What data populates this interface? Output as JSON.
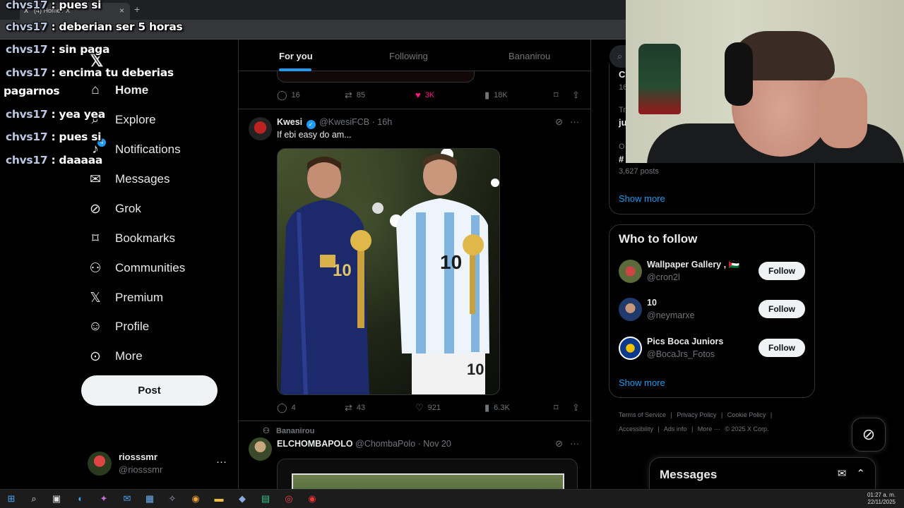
{
  "browser": {
    "tab_title": "(4) Home / X",
    "favicon": "X"
  },
  "chat": [
    {
      "user": "chvs17",
      "text": ": pues si"
    },
    {
      "user": "chvs17",
      "text": ": deberian ser 5 horas"
    },
    {
      "user": "chvs17",
      "text": ": sin paga"
    },
    {
      "user": "chvs17",
      "text": ": encima tu deberias"
    },
    {
      "user": "",
      "text": "pagarnos"
    },
    {
      "user": "chvs17",
      "text": ": yea yea"
    },
    {
      "user": "chvs17",
      "text": ": pues si"
    },
    {
      "user": "chvs17",
      "text": ": daaaaa"
    }
  ],
  "nav": {
    "logo": "𝕏",
    "notification_count": "4",
    "items": [
      {
        "label": "Home",
        "icon": "home-icon"
      },
      {
        "label": "Explore",
        "icon": "search-icon"
      },
      {
        "label": "Notifications",
        "icon": "bell-icon"
      },
      {
        "label": "Messages",
        "icon": "mail-icon"
      },
      {
        "label": "Grok",
        "icon": "grok-icon"
      },
      {
        "label": "Bookmarks",
        "icon": "bookmark-icon"
      },
      {
        "label": "Communities",
        "icon": "communities-icon"
      },
      {
        "label": "Premium",
        "icon": "x-premium-icon"
      },
      {
        "label": "Profile",
        "icon": "profile-icon"
      },
      {
        "label": "More",
        "icon": "more-circle-icon"
      }
    ],
    "post_label": "Post",
    "account": {
      "name": "riosssmr",
      "handle": "@riosssmr",
      "more": "···"
    }
  },
  "feed": {
    "tabs": [
      "For you",
      "Following",
      "Bananirou"
    ],
    "prev_actions": {
      "replies": "16",
      "reposts": "85",
      "likes": "3K",
      "views": "18K"
    },
    "tweet1": {
      "name": "Kwesi",
      "handle": "@KwesiFCB",
      "time": "16h",
      "text": "If ebi easy do am...",
      "replies": "4",
      "reposts": "43",
      "likes": "921",
      "views": "6.3K"
    },
    "tweet2": {
      "context": "Bananirou",
      "name": "ELCHOMBAPOLO",
      "handle": "@ChombaPolo",
      "time": "Nov 20"
    }
  },
  "sidebar": {
    "trend_fragments": [
      "C",
      "16",
      "Tr",
      "ju",
      "O",
      "#"
    ],
    "trend_posts": "3,627 posts",
    "show_more": "Show more",
    "who_to_follow_title": "Who to follow",
    "suggestions": [
      {
        "name": "Wallpaper Gallery , 🇵🇸",
        "handle": "@cron2l",
        "button": "Follow"
      },
      {
        "name": "10",
        "handle": "@neymarxe",
        "button": "Follow"
      },
      {
        "name": "Pics Boca Juniors",
        "handle": "@BocaJrs_Fotos",
        "button": "Follow"
      }
    ],
    "show_more_2": "Show more",
    "footer_line1": [
      "Terms of Service",
      "|",
      "Privacy Policy",
      "|",
      "Cookie Policy",
      "|"
    ],
    "footer_line2": [
      "Accessibility",
      "|",
      "Ads info",
      "|",
      "More ···",
      "© 2025 X Corp."
    ],
    "messages_title": "Messages"
  },
  "taskbar": {
    "time": "01:27 a. m.",
    "date": "22/11/2025"
  },
  "colors": {
    "accent": "#1d9bf0",
    "like": "#f91880",
    "background": "#000000",
    "muted": "#71767b"
  }
}
